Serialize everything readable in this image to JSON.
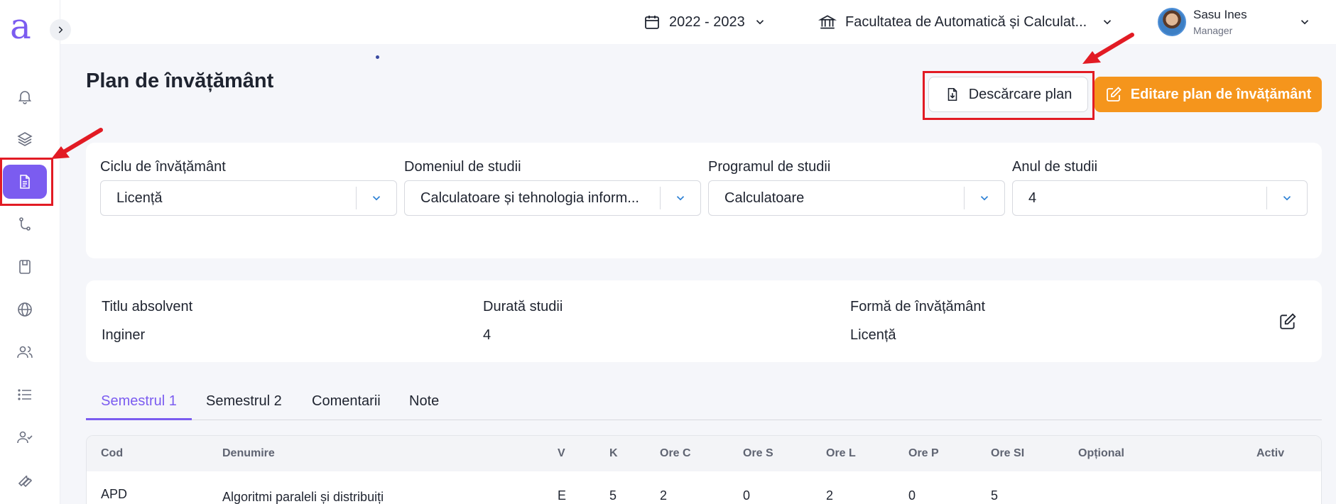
{
  "app": {
    "logo_letter": "a"
  },
  "sidebar": {
    "items": [
      {
        "name": "bell-icon"
      },
      {
        "name": "layers-icon"
      },
      {
        "name": "document-icon",
        "active": true
      },
      {
        "name": "git-branch-icon"
      },
      {
        "name": "book-icon"
      },
      {
        "name": "globe-icon"
      },
      {
        "name": "users-icon"
      },
      {
        "name": "list-icon"
      },
      {
        "name": "user-check-icon"
      },
      {
        "name": "wrench-icon"
      }
    ]
  },
  "topbar": {
    "year": "2022 - 2023",
    "faculty": "Facultatea de Automatică și Calculat...",
    "user_name": "Sasu Ines",
    "user_role": "Manager"
  },
  "page": {
    "title": "Plan de învățământ",
    "download_label": "Descărcare plan",
    "edit_label": "Editare plan de învățământ"
  },
  "filters": {
    "cycle_label": "Ciclu de învățământ",
    "cycle_value": "Licență",
    "domain_label": "Domeniul de studii",
    "domain_value": "Calculatoare și tehnologia inform...",
    "program_label": "Programul de studii",
    "program_value": "Calculatoare",
    "year_label": "Anul de studii",
    "year_value": "4"
  },
  "info": {
    "title_label": "Titlu absolvent",
    "title_value": "Inginer",
    "duration_label": "Durată studii",
    "duration_value": "4",
    "form_label": "Formă de învățământ",
    "form_value": "Licență"
  },
  "tabs": [
    "Semestrul 1",
    "Semestrul 2",
    "Comentarii",
    "Note"
  ],
  "table": {
    "headers": [
      "Cod",
      "Denumire",
      "V",
      "K",
      "Ore C",
      "Ore S",
      "Ore L",
      "Ore P",
      "Ore SI",
      "Opțional",
      "Activ"
    ],
    "rows": [
      [
        "APD",
        "Algoritmi paraleli și distribuiți",
        "E",
        "5",
        "2",
        "0",
        "2",
        "0",
        "5",
        "",
        ""
      ]
    ]
  },
  "colors": {
    "accent": "#7b5cf0",
    "orange": "#f5951c",
    "highlight": "#e21b24"
  }
}
